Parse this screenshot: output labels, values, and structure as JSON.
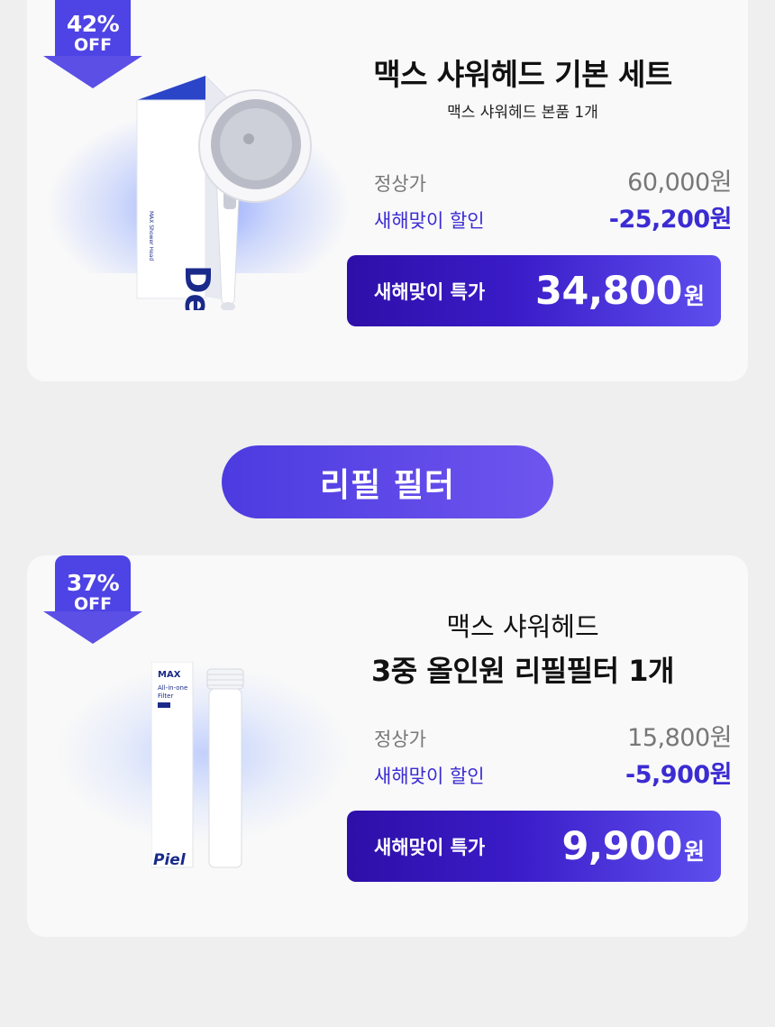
{
  "colors": {
    "accent": "#4e43e4",
    "discount": "#3b2cd2",
    "sale_gradient_start": "#2e0fa8",
    "sale_gradient_end": "#5e4fee",
    "background": "#efefef",
    "card": "#f9f9f9"
  },
  "products": [
    {
      "badge": {
        "percent": "42%",
        "off": "OFF"
      },
      "title_line1": "맥스 샤워헤드 기본 세트",
      "subtitle": "맥스 샤워헤드 본품 1개",
      "regular_label": "정상가",
      "regular_price": "60,000원",
      "discount_label": "새해맞이 할인",
      "discount_value": "-25,200원",
      "sale_label": "새해맞이 특가",
      "sale_price": "34,800",
      "sale_unit": "원",
      "image_icon": "shower-head-product-image"
    },
    {
      "badge": {
        "percent": "37%",
        "off": "OFF"
      },
      "title_line1": "맥스 샤워헤드",
      "title_line2": "3중 올인원 리필필터 1개",
      "regular_label": "정상가",
      "regular_price": "15,800원",
      "discount_label": "새해맞이 할인",
      "discount_value": "-5,900원",
      "sale_label": "새해맞이 특가",
      "sale_price": "9,900",
      "sale_unit": "원",
      "image_icon": "refill-filter-product-image",
      "box_text": {
        "brand": "MAX",
        "line1": "All-in-one",
        "line2": "Filter",
        "logo": "Piel"
      }
    }
  ],
  "section_pill": "리필 필터"
}
